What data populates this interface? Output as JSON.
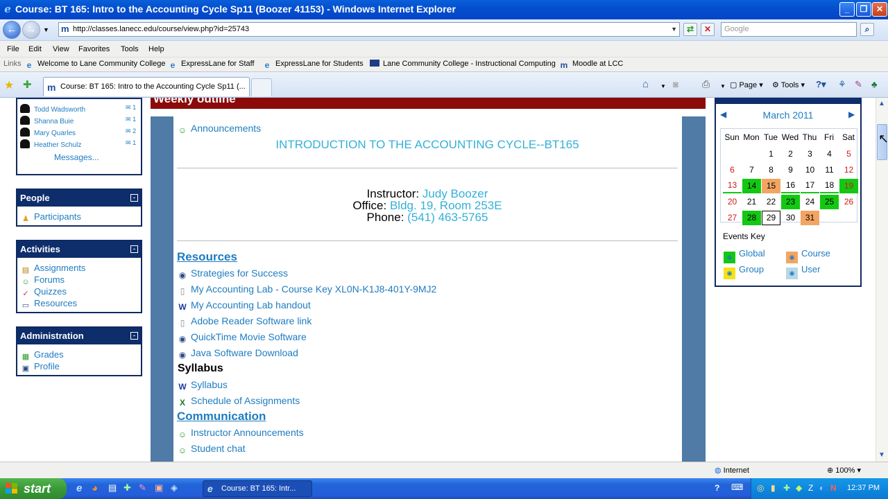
{
  "window": {
    "title": "Course: BT 165: Intro to the Accounting Cycle Sp11 (Boozer 41153) - Windows Internet Explorer"
  },
  "address": {
    "url": "http://classes.lanecc.edu/course/view.php?id=25743",
    "search_placeholder": "Google"
  },
  "menu": [
    "File",
    "Edit",
    "View",
    "Favorites",
    "Tools",
    "Help"
  ],
  "links": {
    "label": "Links",
    "items": [
      "Welcome to Lane Community College",
      "ExpressLane for Staff",
      "ExpressLane for Students",
      "Lane Community College - Instructional Computing",
      "Moodle at LCC"
    ]
  },
  "tab": {
    "title": "Course: BT 165: Intro to the Accounting Cycle Sp11 (..."
  },
  "commandbar": {
    "page": "Page",
    "tools": "Tools"
  },
  "messages": {
    "users": [
      {
        "name": "Todd Wadsworth",
        "count": "1"
      },
      {
        "name": "Shanna Buie",
        "count": "1"
      },
      {
        "name": "Mary Quarles",
        "count": "2"
      },
      {
        "name": "Heather Schulz",
        "count": "1"
      }
    ],
    "link": "Messages..."
  },
  "people": {
    "title": "People",
    "items": [
      "Participants"
    ]
  },
  "activities": {
    "title": "Activities",
    "items": [
      "Assignments",
      "Forums",
      "Quizzes",
      "Resources"
    ]
  },
  "administration": {
    "title": "Administration",
    "items": [
      "Grades",
      "Profile"
    ]
  },
  "main": {
    "outline_title": "Weekly outline",
    "announcements": "Announcements",
    "course_title": "INTRODUCTION TO THE ACCOUNTING CYCLE--BT165",
    "instructor_label": "Instructor:",
    "instructor": "Judy Boozer",
    "office_label": "Office:",
    "office": "Bldg. 19, Room 253E",
    "phone_label": "Phone:",
    "phone": "(541) 463-5765",
    "resources_heading": "Resources",
    "resources": [
      "Strategies for Success",
      "My Accounting Lab - Course Key XL0N-K1J8-401Y-9MJ2",
      "My Accounting Lab handout",
      "Adobe Reader Software link",
      "QuickTime Movie Software",
      "Java Software Download"
    ],
    "syllabus_heading": "Syllabus",
    "syllabus": [
      "Syllabus",
      "Schedule of Assignments"
    ],
    "communication_heading": "Communication",
    "communication": [
      "Instructor Announcements",
      "Student chat"
    ]
  },
  "calendar": {
    "month": "March 2011",
    "day_headers": [
      "Sun",
      "Mon",
      "Tue",
      "Wed",
      "Thu",
      "Fri",
      "Sat"
    ],
    "weeks": [
      [
        "",
        "",
        "1",
        "2",
        "3",
        "4",
        "5"
      ],
      [
        "6",
        "7",
        "8",
        "9",
        "10",
        "11",
        "12"
      ],
      [
        "13",
        "14",
        "15",
        "16",
        "17",
        "18",
        "19"
      ],
      [
        "20",
        "21",
        "22",
        "23",
        "24",
        "25",
        "26"
      ],
      [
        "27",
        "28",
        "29",
        "30",
        "31",
        "",
        ""
      ]
    ],
    "today": "29",
    "global_event_days": [
      "14",
      "19",
      "23",
      "25",
      "28"
    ],
    "course_event_days": [
      "15",
      "31"
    ],
    "events_key_title": "Events Key",
    "events_key": [
      "Global",
      "Course",
      "Group",
      "User"
    ]
  },
  "status": {
    "zone": "Internet",
    "zoom": "100%"
  },
  "taskbar": {
    "start": "start",
    "window_button": "Course: BT 165: Intr...",
    "clock": "12:37 PM"
  },
  "colors": {
    "link": "#1e7cc0",
    "block_header": "#0e2d6b",
    "global": "#13c813",
    "course": "#f2a562"
  }
}
